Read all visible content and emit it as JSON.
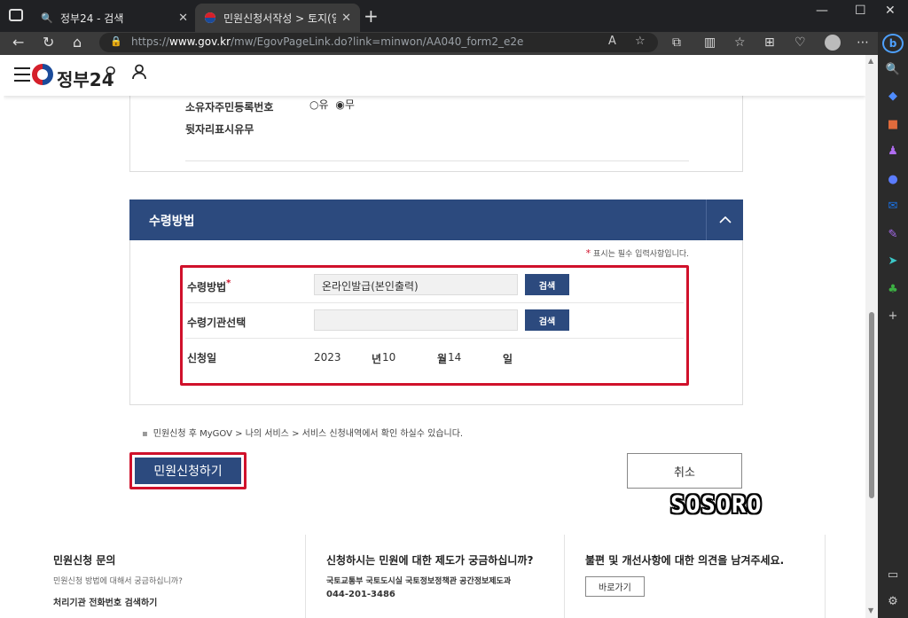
{
  "browser": {
    "tabs": [
      {
        "title": "정부24 - 검색",
        "favicon": "search-icon",
        "active": false
      },
      {
        "title": "민원신청서작성 > 토지(임야)대장",
        "favicon": "gov24-icon",
        "active": true
      }
    ],
    "address": {
      "url_prefix": "https://",
      "url_domain": "www.gov.kr",
      "url_path": "/mw/EgovPageLink.do?link=minwon/AA040_form2_e2e"
    }
  },
  "site": {
    "logo_text": "정부24"
  },
  "prev_section": {
    "resident_label_line1": "소유자주민등록번호",
    "resident_label_line2": "뒷자리표시유무",
    "radio_yes": "유",
    "radio_no": "무"
  },
  "receive_section": {
    "title": "수령방법",
    "required_note": "표시는 필수 입력사항입니다.",
    "rows": {
      "method_label": "수령방법",
      "method_value": "온라인발급(본인출력)",
      "agency_label": "수령기관선택",
      "agency_value": "",
      "search_label": "검색",
      "date_label": "신청일",
      "year": "2023",
      "year_unit": "년",
      "month": "10",
      "month_unit": "월",
      "day": "14",
      "day_unit": "일"
    }
  },
  "notice": "민원신청 후 MyGOV > 나의 서비스 > 서비스 신청내역에서 확인 하실수 있습니다.",
  "actions": {
    "submit": "민원신청하기",
    "cancel": "취소"
  },
  "watermark": "SOSORO",
  "footer": {
    "col1_title": "민원신청 문의",
    "col1_sub": "민원신청 방법에 대해서 궁금하십니까?",
    "col1_link": "처리기관 전화번호 검색하기",
    "col2_title": "신청하시는 민원에 대한 제도가 궁금하십니까?",
    "col2_sub": "국토교통부 국토도시실 국토정보정책관 공간정보제도과",
    "col2_phone": "044-201-3486",
    "col3_title": "불편 및 개선사항에 대한 의견을 남겨주세요.",
    "col3_button": "바로가기"
  }
}
